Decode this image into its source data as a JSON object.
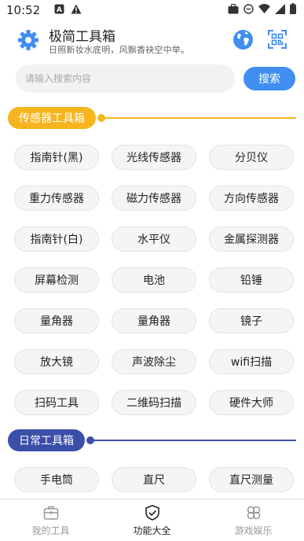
{
  "status_bar": {
    "time": "10:52",
    "left_icons": [
      "a-icon",
      "warning-icon"
    ],
    "right_icons": [
      "briefcase-icon",
      "dnd-icon",
      "wifi-icon",
      "signal-icon",
      "battery-icon"
    ]
  },
  "header": {
    "title": "极简工具箱",
    "subtitle": "日照新妆水底明，风飘香袂空中举。"
  },
  "search": {
    "placeholder": "请输入搜索内容",
    "button_label": "搜索"
  },
  "colors": {
    "accent": "#3f8ef0",
    "sensor_section": "#f6b51f",
    "daily_section": "#3b4ea8"
  },
  "sensor_section": {
    "title": "传感器工具箱",
    "items": [
      "指南针(黑)",
      "光线传感器",
      "分贝仪",
      "重力传感器",
      "磁力传感器",
      "方向传感器",
      "指南针(白)",
      "水平仪",
      "金属探测器",
      "屏幕检测",
      "电池",
      "铅锤",
      "量角器",
      "量角器",
      "镜子",
      "放大镜",
      "声波除尘",
      "wifi扫描",
      "扫码工具",
      "二维码扫描",
      "硬件大师"
    ]
  },
  "daily_section": {
    "title": "日常工具箱",
    "items": [
      "手电筒",
      "直尺",
      "直尺测量"
    ]
  },
  "tabbar": {
    "tabs": [
      {
        "label": "我的工具",
        "icon": "toolbox-icon",
        "active": false
      },
      {
        "label": "功能大全",
        "icon": "shield-check-icon",
        "active": true
      },
      {
        "label": "游戏娱乐",
        "icon": "clover-icon",
        "active": false
      }
    ]
  }
}
